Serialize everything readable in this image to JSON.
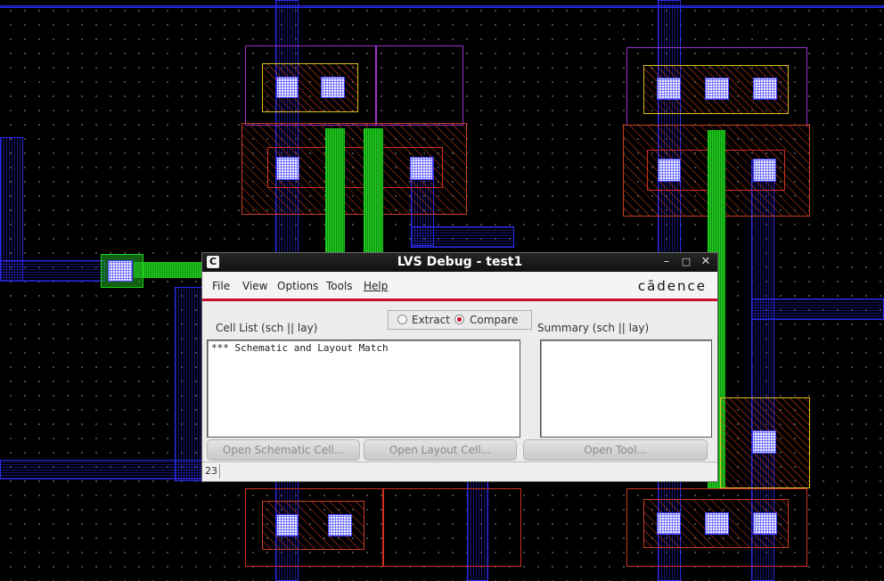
{
  "window": {
    "title": "LVS Debug - test1",
    "app_icon": "cadence-c-icon",
    "app_icon_glyph": "C",
    "minimize_glyph": "–",
    "maximize_glyph": "□",
    "close_glyph": "✕"
  },
  "menubar": {
    "items": [
      "File",
      "View",
      "Options",
      "Tools",
      "Help"
    ],
    "brand": "cādence"
  },
  "mode": {
    "options": [
      "Extract",
      "Compare"
    ],
    "selected": "Compare"
  },
  "cell_list": {
    "label": "Cell List (sch || lay)",
    "items": [
      "*** Schematic and Layout Match"
    ]
  },
  "summary": {
    "label": "Summary (sch || lay)",
    "items": []
  },
  "buttons": {
    "open_schematic": "Open Schematic Cell...",
    "open_layout": "Open Layout Cell...",
    "open_tool": "Open Tool..."
  },
  "status": {
    "count": "23"
  },
  "colors": {
    "accent_red": "#c8102e",
    "metal1": "#2a2af0",
    "poly": "#22d022",
    "nwell": "#9a30d0",
    "diffusion": "#c84020"
  }
}
